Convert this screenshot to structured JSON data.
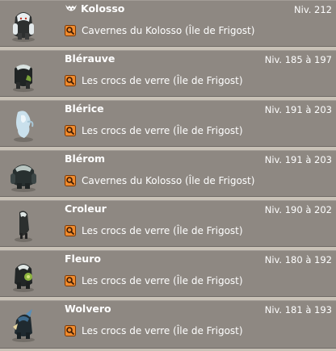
{
  "monsters": [
    {
      "name": "Kolosso",
      "level": "Niv. 212",
      "location": "Cavernes du Kolosso (Île de Frigost)",
      "boss": true,
      "portrait_icon": "kolosso-portrait"
    },
    {
      "name": "Blérauve",
      "level": "Niv. 185 à 197",
      "location": "Les crocs de verre (Île de Frigost)",
      "boss": false,
      "portrait_icon": "blerauve-portrait"
    },
    {
      "name": "Blérice",
      "level": "Niv. 191 à 203",
      "location": "Les crocs de verre (Île de Frigost)",
      "boss": false,
      "portrait_icon": "blerice-portrait"
    },
    {
      "name": "Blérom",
      "level": "Niv. 191 à 203",
      "location": "Cavernes du Kolosso (Île de Frigost)",
      "boss": false,
      "portrait_icon": "blerom-portrait"
    },
    {
      "name": "Croleur",
      "level": "Niv. 190 à 202",
      "location": "Les crocs de verre (Île de Frigost)",
      "boss": false,
      "portrait_icon": "croleur-portrait"
    },
    {
      "name": "Fleuro",
      "level": "Niv. 180 à 192",
      "location": "Les crocs de verre (Île de Frigost)",
      "boss": false,
      "portrait_icon": "fleuro-portrait"
    },
    {
      "name": "Wolvero",
      "level": "Niv. 181 à 193",
      "location": "Les crocs de verre (Île de Frigost)",
      "boss": false,
      "portrait_icon": "wolvero-portrait"
    }
  ],
  "colors": {
    "row_bg": "#8e8882",
    "separator": "#c9c2b7",
    "text": "#ffffff",
    "search_icon_bg": "#f08a2c"
  }
}
